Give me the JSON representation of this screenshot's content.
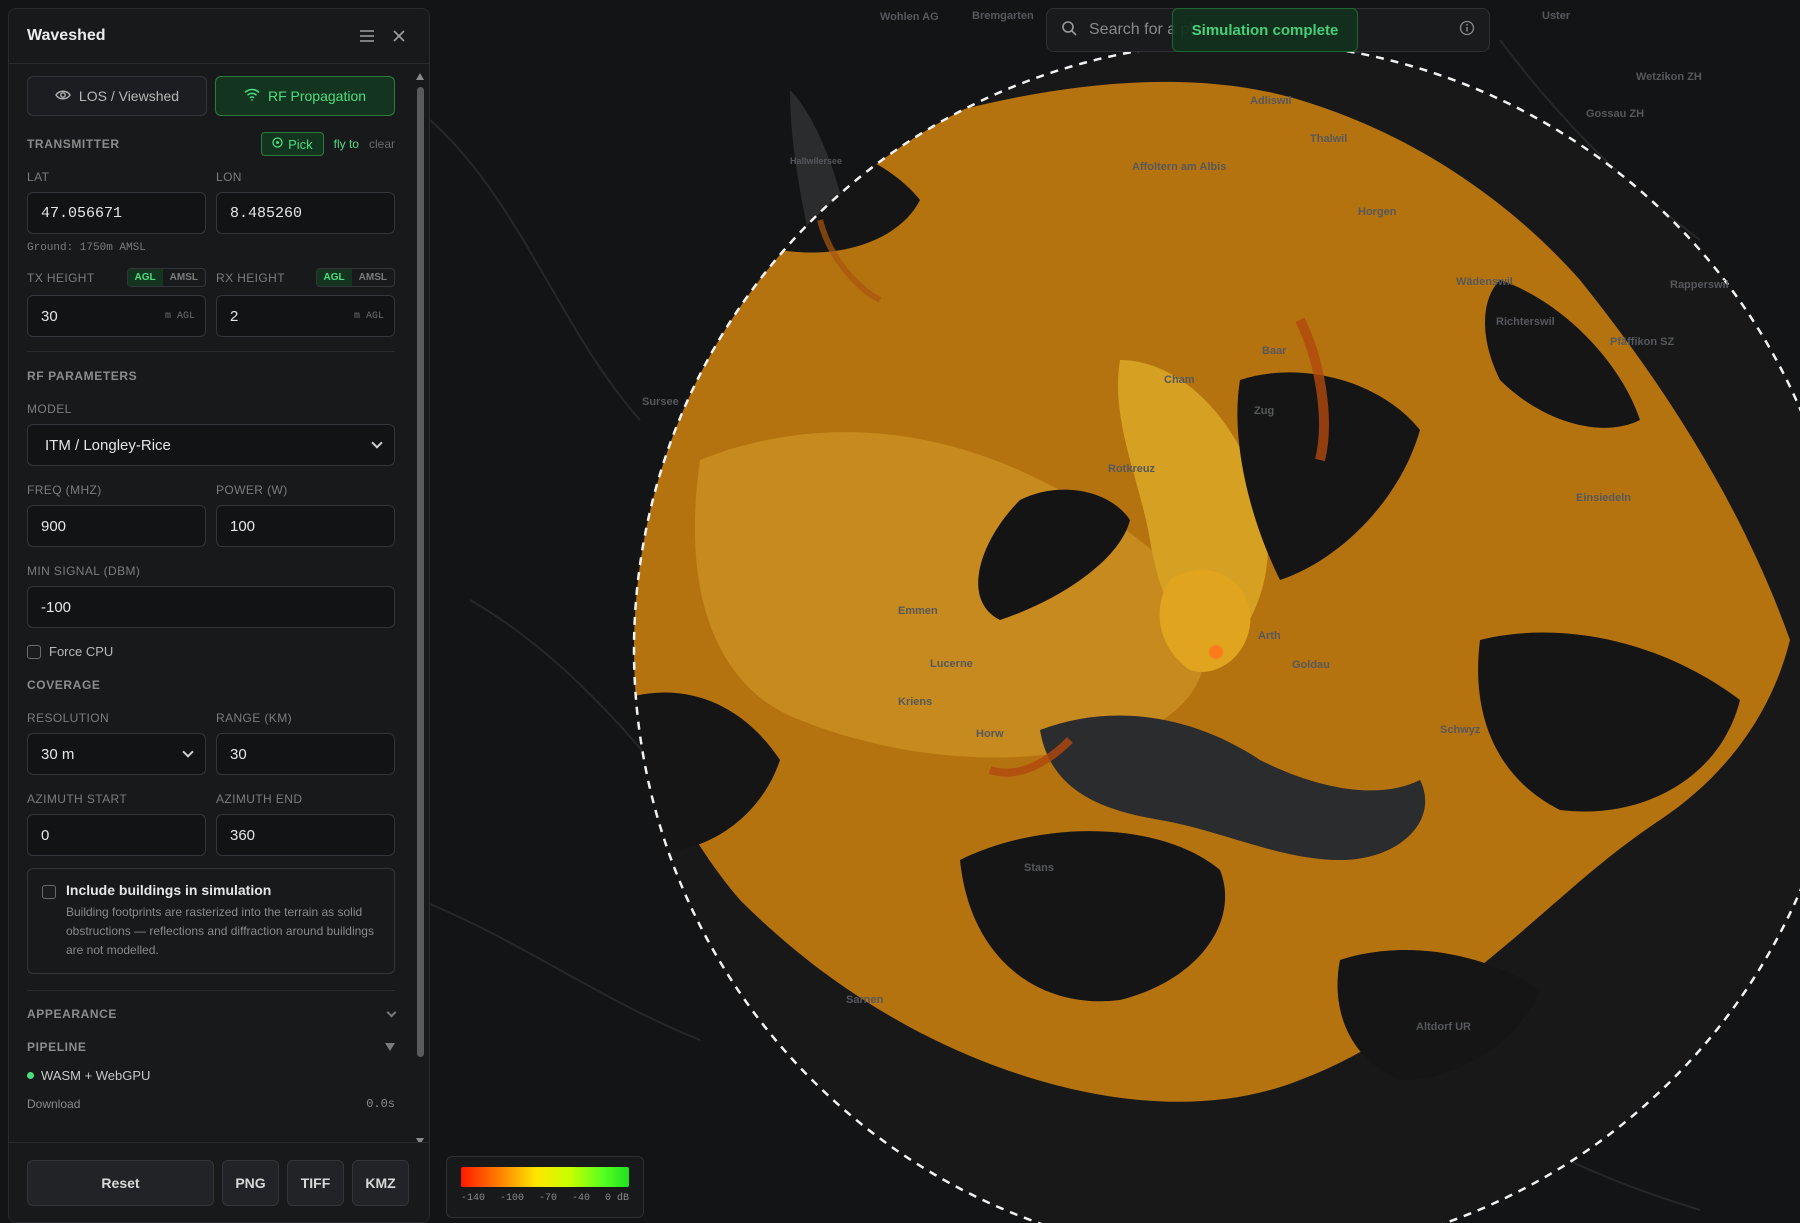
{
  "panel": {
    "title": "Waveshed",
    "tabs": [
      {
        "label": "LOS / Viewshed",
        "icon": "eye-icon"
      },
      {
        "label": "RF Propagation",
        "icon": "wifi-icon"
      }
    ],
    "transmitter": {
      "section": "TRANSMITTER",
      "pick": "Pick",
      "fly_to": "fly to",
      "clear": "clear",
      "lat_label": "LAT",
      "lon_label": "LON",
      "lat": "47.056671",
      "lon": "8.485260",
      "ground": "Ground: 1750m AMSL",
      "tx_height_label": "TX HEIGHT",
      "rx_height_label": "RX HEIGHT",
      "agl": "AGL",
      "amsl": "AMSL",
      "tx_height": "30",
      "rx_height": "2",
      "unit": "m AGL"
    },
    "rf": {
      "section": "RF PARAMETERS",
      "model_label": "MODEL",
      "model": "ITM / Longley-Rice",
      "freq_label": "FREQ (MHZ)",
      "freq": "900",
      "power_label": "POWER (W)",
      "power": "100",
      "min_signal_label": "MIN SIGNAL (DBM)",
      "min_signal": "-100",
      "force_cpu": "Force CPU"
    },
    "coverage": {
      "section": "COVERAGE",
      "resolution_label": "RESOLUTION",
      "resolution": "30 m",
      "range_label": "RANGE (KM)",
      "range": "30",
      "az_start_label": "AZIMUTH START",
      "az_start": "0",
      "az_end_label": "AZIMUTH END",
      "az_end": "360",
      "buildings_title": "Include buildings in simulation",
      "buildings_desc": "Building footprints are rasterized into the terrain as solid obstructions — reflections and diffraction around buildings are not modelled."
    },
    "appearance": "APPEARANCE",
    "pipeline": {
      "section": "PIPELINE",
      "backend": "WASM + WebGPU",
      "download_label": "Download",
      "download_time": "0.0s"
    },
    "footer": {
      "reset": "Reset",
      "png": "PNG",
      "tiff": "TIFF",
      "kmz": "KMZ"
    }
  },
  "search": {
    "placeholder": "Search for a place..."
  },
  "toast": "Simulation complete",
  "legend": {
    "ticks": [
      "-140",
      "-100",
      "-70",
      "-40",
      "0 dB"
    ]
  },
  "map_labels": [
    "Wohlen AG",
    "Bremgarten",
    "Uster",
    "Wetzikon ZH",
    "Adliswil",
    "Gossau ZH",
    "Thalwil",
    "Affoltern am Albis",
    "Horgen",
    "Hallwilersee",
    "Wädenswil",
    "Rapperswil",
    "Richterswil",
    "Pfäffikon SZ",
    "Baar",
    "Cham",
    "Zug",
    "Sursee",
    "Rotkreuz",
    "Einsiedeln",
    "Emmen",
    "Lucerne",
    "Arth",
    "Goldau",
    "Kriens",
    "Horw",
    "Schwyz",
    "Stans",
    "Altdorf UR",
    "Sarnen"
  ],
  "colors": {
    "accent": "#4ade80",
    "coverage": "#d98b1a",
    "transmitter": "#ff7a1a"
  }
}
